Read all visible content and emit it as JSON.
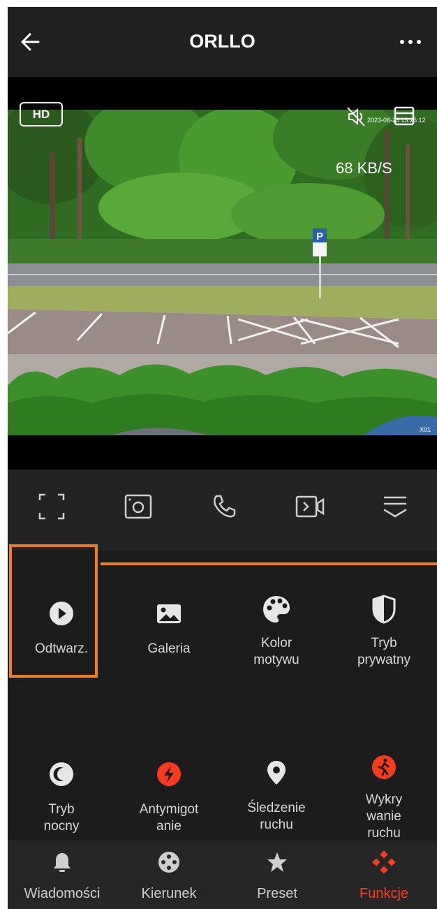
{
  "header": {
    "title": "ORLLO"
  },
  "video": {
    "quality_badge": "HD",
    "speed": "68 KB/S",
    "timestamp": "2023-06-23  13:25:12",
    "channel": "X01"
  },
  "controls": {
    "icons": [
      "fullscreen-icon",
      "snapshot-icon",
      "call-icon",
      "record-icon",
      "collapse-menu-icon"
    ]
  },
  "features": [
    {
      "label": "Odtwarz.",
      "icon": "play-icon"
    },
    {
      "label": "Galeria",
      "icon": "image-icon"
    },
    {
      "label": "Kolor\nmotywu",
      "icon": "palette-icon"
    },
    {
      "label": "Tryb\nprywatny",
      "icon": "shield-half-icon"
    },
    {
      "label": "Tryb\nnocny",
      "icon": "moon-icon"
    },
    {
      "label": "Antymigot\nanie",
      "icon": "lightning-icon"
    },
    {
      "label": "Śledzenie\nruchu",
      "icon": "location-pin-icon"
    },
    {
      "label": "Wykry\nwanie\nruchu",
      "icon": "running-person-icon"
    }
  ],
  "tabs": [
    {
      "label": "Wiadomości",
      "icon": "bell-icon",
      "active": false
    },
    {
      "label": "Kierunek",
      "icon": "direction-pad-icon",
      "active": false
    },
    {
      "label": "Preset",
      "icon": "star-icon",
      "active": false
    },
    {
      "label": "Funkcje",
      "icon": "functions-icon",
      "active": true
    }
  ],
  "colors": {
    "accent": "#ff3b1f",
    "highlight": "#ee7d1a",
    "background": "#1c1c1c",
    "text": "#d9d9d9"
  }
}
